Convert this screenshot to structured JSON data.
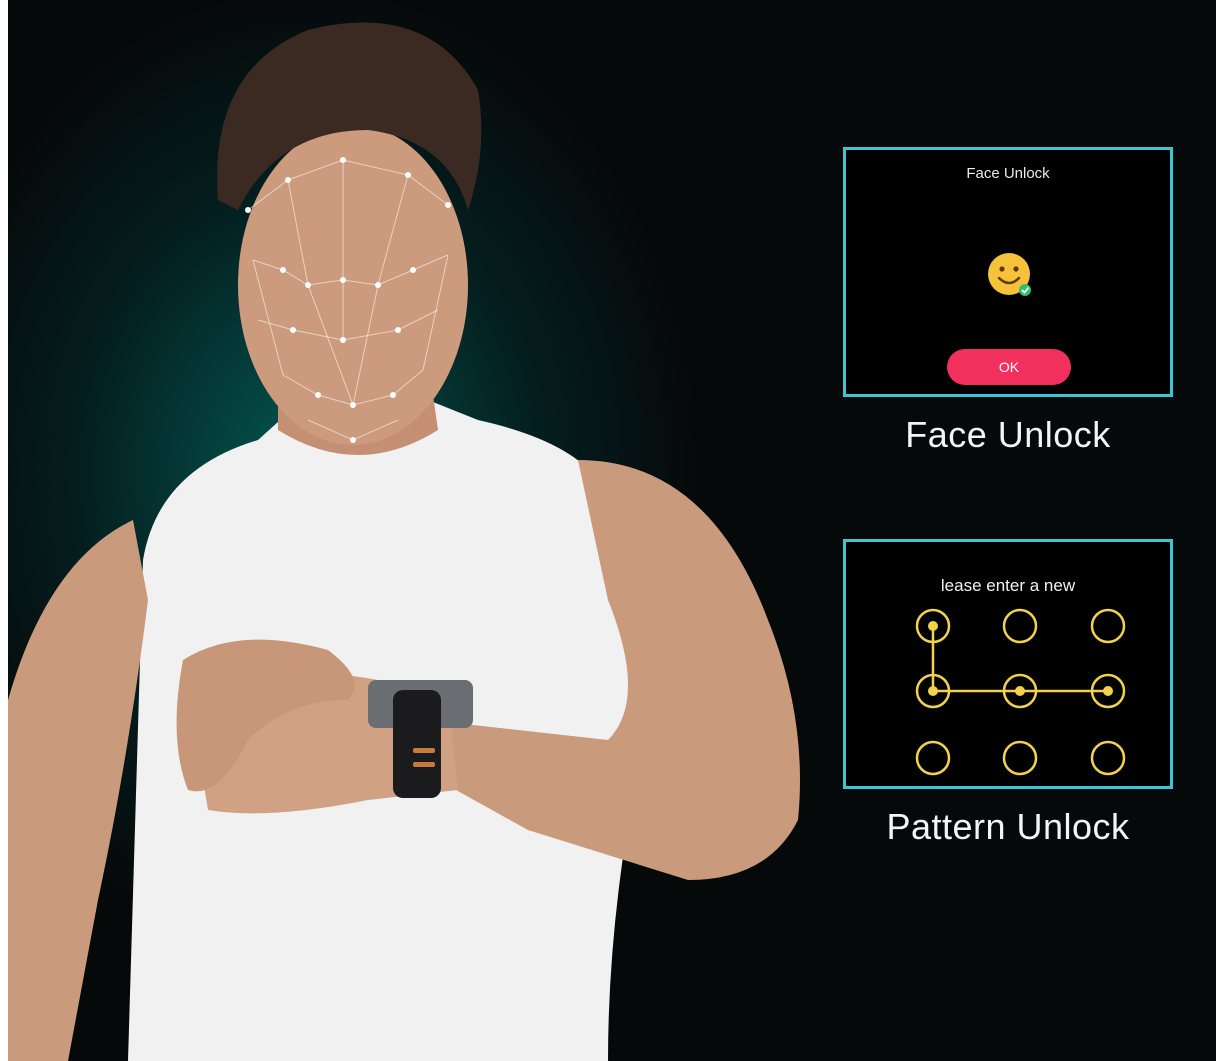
{
  "face_unlock": {
    "screen_title": "Face Unlock",
    "icon": "smiley-face-check-icon",
    "ok_label": "OK",
    "caption": "Face Unlock"
  },
  "pattern_unlock": {
    "prompt": "lease enter a new",
    "active_points": [
      "top-left",
      "middle-left",
      "middle-center",
      "middle-right"
    ],
    "caption": "Pattern Unlock"
  },
  "colors": {
    "panel_border": "#3fc4d4",
    "ok_button": "#f2305e",
    "pattern": "#f2d24a",
    "background_glow": "#009688"
  }
}
